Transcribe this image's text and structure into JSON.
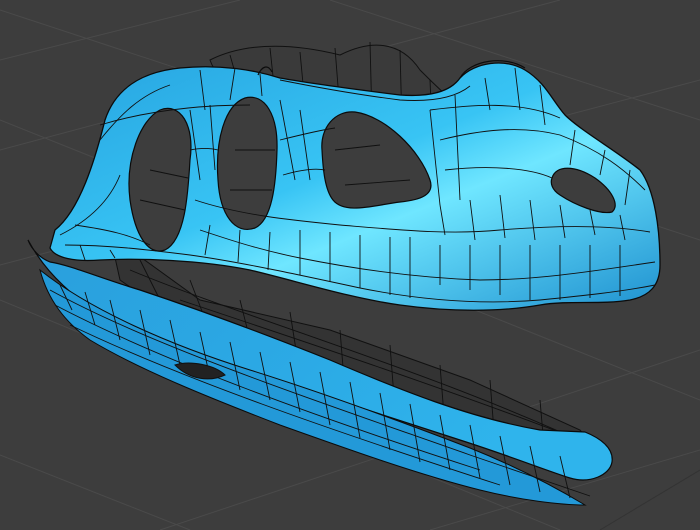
{
  "viewport": {
    "background": "#3d3d3d",
    "grid_color": "#4a4a4a",
    "mesh_color": "#2fb4ea",
    "mesh_highlight": "#6fe6ff",
    "mesh_shadow": "#1479b4",
    "wire_color": "#101010",
    "shading": "solid-with-wireframe",
    "model": "dinosaur-skull",
    "axis_hint_color": "#8a3a3a"
  }
}
